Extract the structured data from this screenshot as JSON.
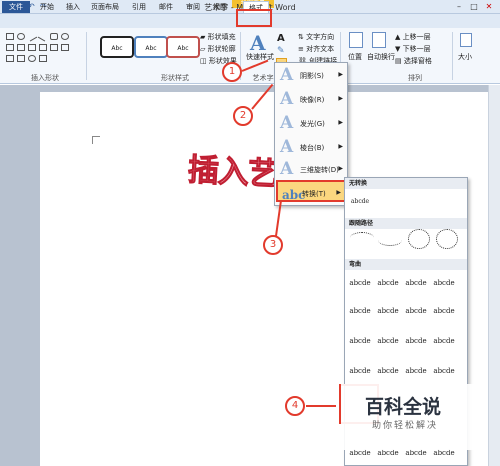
{
  "window": {
    "title": "艺术字 - Microsoft Word",
    "contextual_tab": "绘图工具"
  },
  "tabs": [
    "文件",
    "开始",
    "插入",
    "页面布局",
    "引用",
    "邮件",
    "审阅",
    "视图",
    "格式"
  ],
  "ribbon": {
    "groups": {
      "insert_shapes": "插入形状",
      "shape_styles": "形状样式",
      "wordart_styles": "艺术字样式",
      "arrange": "排列"
    },
    "shape_style_buttons": [
      "Abc",
      "Abc",
      "Abc"
    ],
    "shape_fill": "形状填充",
    "shape_outline": "形状轮廓",
    "shape_effects": "形状效果",
    "quick_styles": "快速样式",
    "text_direction": "文字方向",
    "align_text": "对齐文本",
    "create_link": "创建链接",
    "position": "位置",
    "wrap_text": "自动换行",
    "bring_forward": "上移一层",
    "send_backward": "下移一层",
    "selection_pane": "选择窗格",
    "size": "大小"
  },
  "document": {
    "wordart_text": "插入艺术字"
  },
  "text_effects_menu": [
    {
      "label": "阴影(S)"
    },
    {
      "label": "映像(R)"
    },
    {
      "label": "发光(G)"
    },
    {
      "label": "棱台(B)"
    },
    {
      "label": "三维旋转(D)"
    },
    {
      "label": "转换(T)"
    }
  ],
  "transform_gallery": {
    "no_transform": "无转换",
    "no_transform_sample": "abcde",
    "follow_path": "跟随路径",
    "warp": "弯曲",
    "sample": "abcde"
  },
  "callouts": [
    "1",
    "2",
    "3",
    "4"
  ],
  "watermark": {
    "title": "百科全说",
    "subtitle": "助你轻松解决"
  },
  "colors": {
    "accent": "#e23a2c",
    "file_tab": "#2b5797",
    "ribbon": "#f3f7fc",
    "highlight": "#fbd77f"
  }
}
